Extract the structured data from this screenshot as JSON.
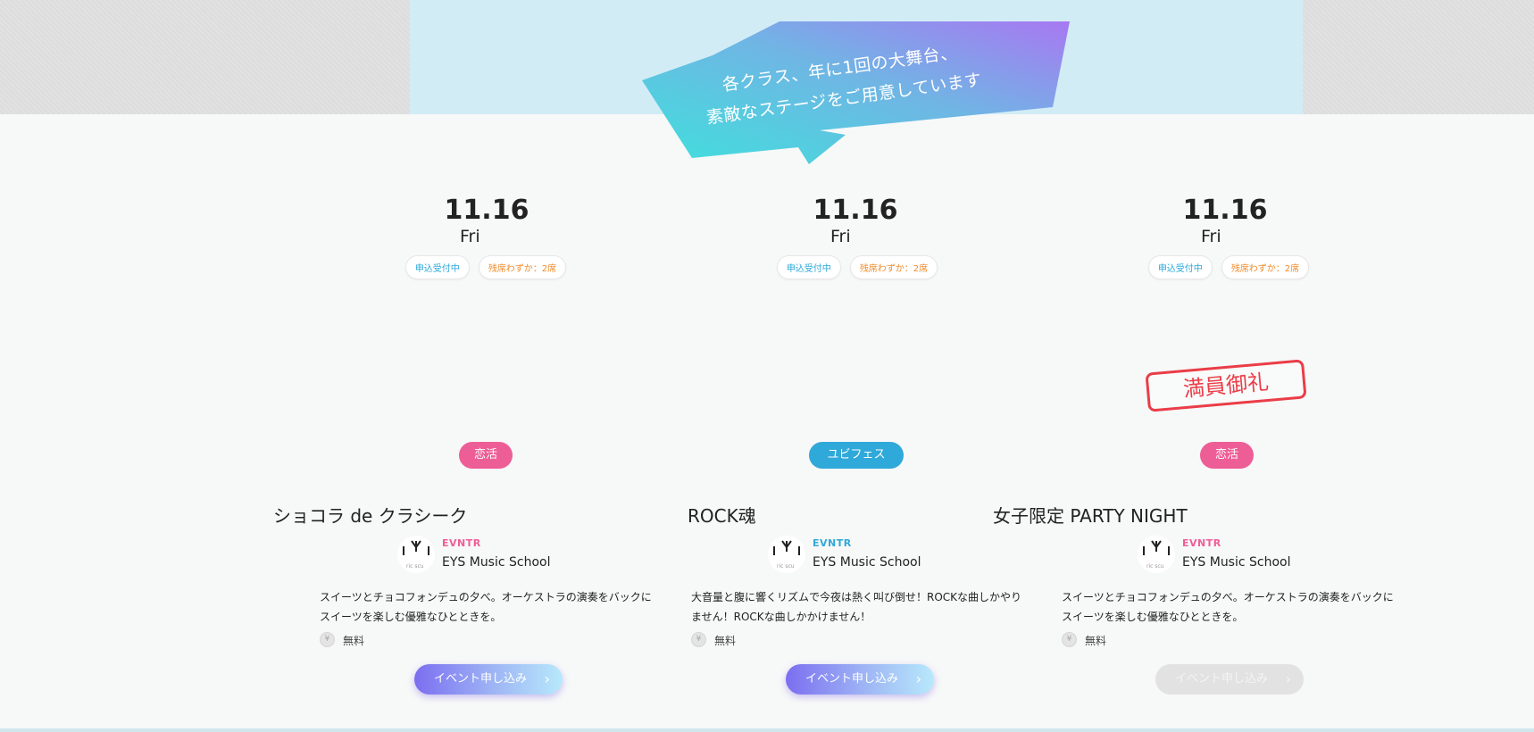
{
  "hero": {
    "line1": "各クラス、年に1回の大舞台、",
    "line2": "素敵なステージをご用意しています"
  },
  "events": [
    {
      "date": "11.16",
      "dow": "Fri",
      "status": "申込受付中",
      "seats": "残席わずか：2席",
      "category": "恋活",
      "title": "ショコラ de クラシーク",
      "brand": "EVNTR",
      "organizer": "EYS Music School",
      "description": "スイーツとチョコフォンデュの夕べ。オーケストラの演奏をバックにスイーツを楽しむ優雅なひとときを。",
      "price": "無料",
      "apply": "イベント申し込み",
      "sold_out": false
    },
    {
      "date": "11.16",
      "dow": "Fri",
      "status": "申込受付中",
      "seats": "残席わずか：2席",
      "category": "ユビフェス",
      "title": "ROCK魂",
      "brand": "EVNTR",
      "organizer": "EYS Music School",
      "description": "大音量と腹に響くリズムで今夜は熱く叫び倒せ！ROCKな曲しかやりません！ROCKな曲しかかけません！",
      "price": "無料",
      "apply": "イベント申し込み",
      "sold_out": false
    },
    {
      "date": "11.16",
      "dow": "Fri",
      "status": "申込受付中",
      "seats": "残席わずか：2席",
      "category": "恋活",
      "title": "女子限定 PARTY NIGHT",
      "brand": "EVNTR",
      "organizer": "EYS Music School",
      "description": "スイーツとチョコフォンデュの夕べ。オーケストラの演奏をバックにスイーツを楽しむ優雅なひとときを。",
      "price": "無料",
      "apply": "イベント申し込み",
      "sold_out": true,
      "stamp": "満員御礼"
    }
  ],
  "colors": {
    "pink": "#ee5e96",
    "blue": "#2fa9d9",
    "stamp_red": "#ea3d47",
    "banner_start": "#3fe0dc",
    "banner_end": "#a878f2"
  }
}
